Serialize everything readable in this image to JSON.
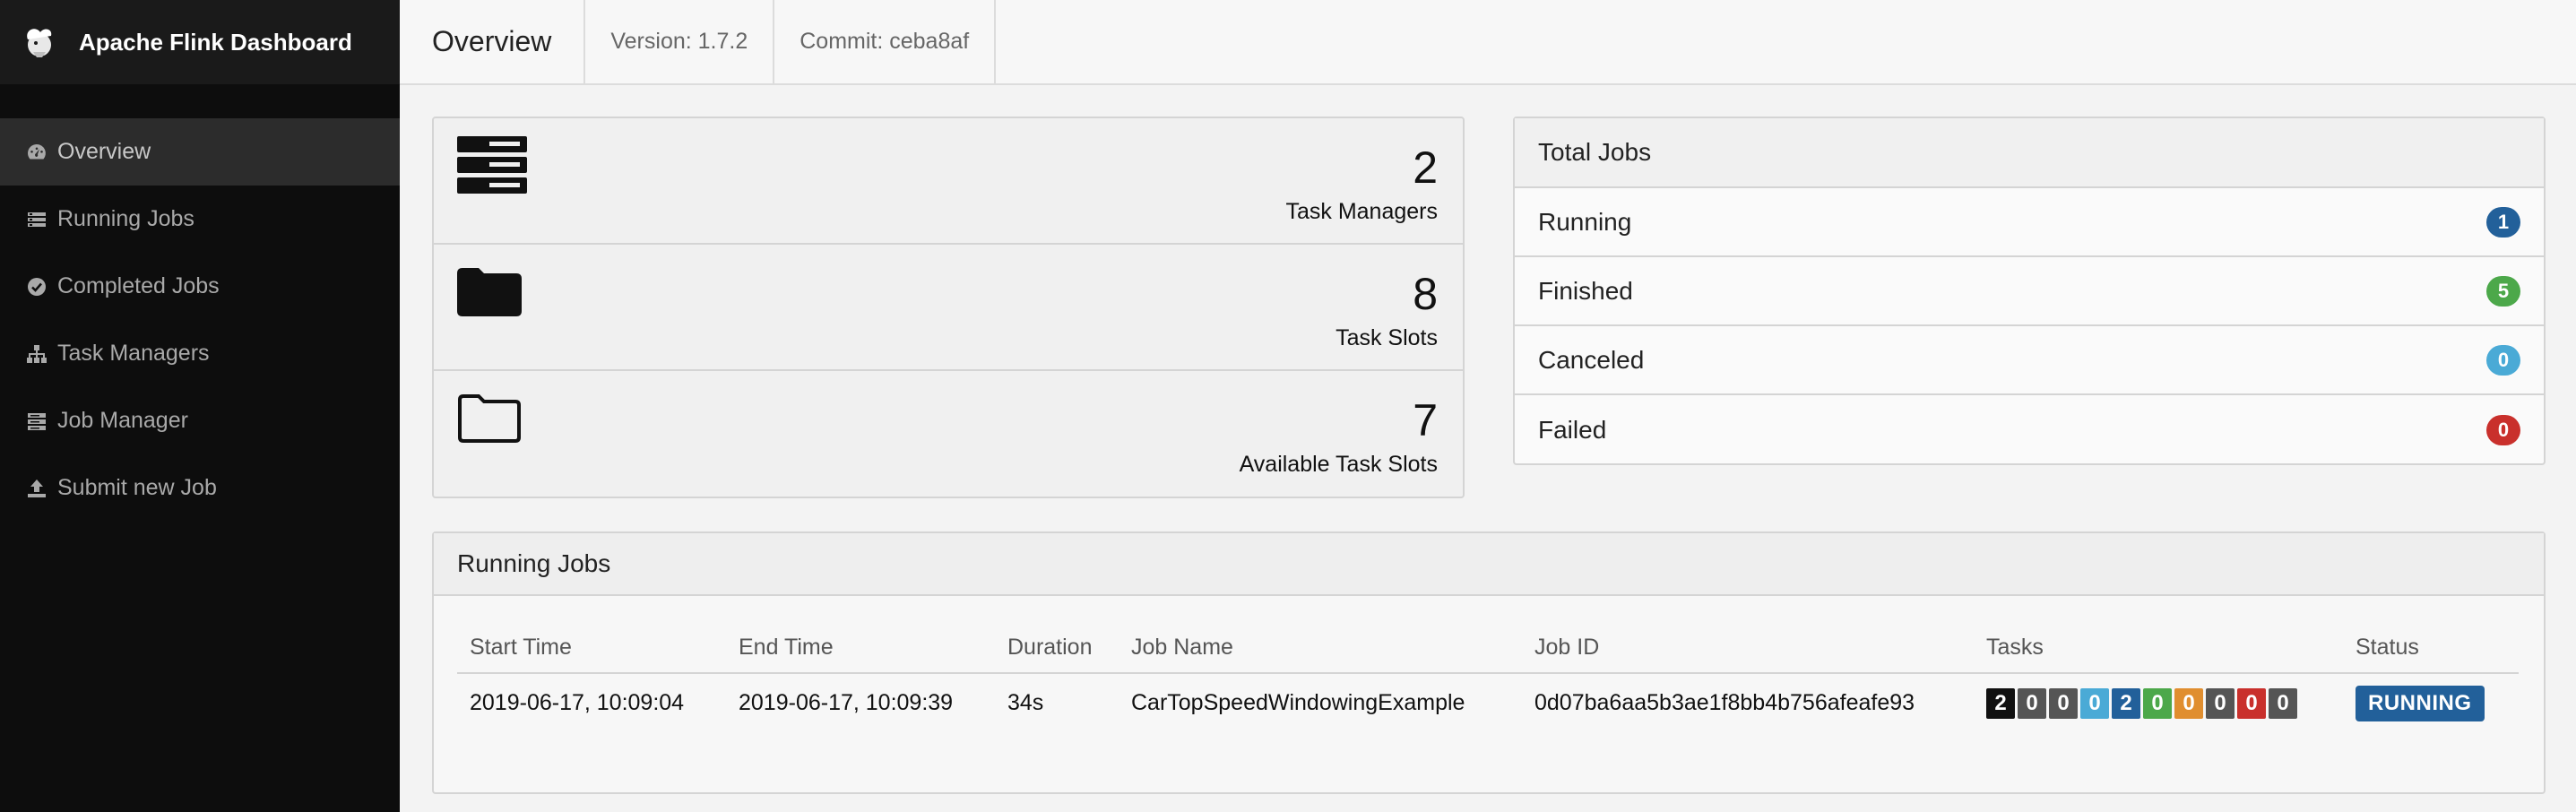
{
  "app": {
    "title": "Apache Flink Dashboard"
  },
  "sidebar": {
    "items": [
      {
        "label": "Overview",
        "icon": "dashboard-icon",
        "active": true
      },
      {
        "label": "Running Jobs",
        "icon": "tasks-icon"
      },
      {
        "label": "Completed Jobs",
        "icon": "check-circle-icon"
      },
      {
        "label": "Task Managers",
        "icon": "sitemap-icon"
      },
      {
        "label": "Job Manager",
        "icon": "server-icon"
      },
      {
        "label": "Submit new Job",
        "icon": "upload-icon"
      }
    ]
  },
  "header": {
    "title": "Overview",
    "version": "Version: 1.7.2",
    "commit": "Commit: ceba8af"
  },
  "stats": [
    {
      "value": "2",
      "label": "Task Managers",
      "icon": "server-icon"
    },
    {
      "value": "8",
      "label": "Task Slots",
      "icon": "folder-icon"
    },
    {
      "value": "7",
      "label": "Available Task Slots",
      "icon": "folder-open-icon"
    }
  ],
  "total_jobs": {
    "title": "Total Jobs",
    "rows": [
      {
        "label": "Running",
        "count": "1",
        "color": "#22609a"
      },
      {
        "label": "Finished",
        "count": "5",
        "color": "#4ca84a"
      },
      {
        "label": "Canceled",
        "count": "0",
        "color": "#4aaad6"
      },
      {
        "label": "Failed",
        "count": "0",
        "color": "#c9302c"
      }
    ]
  },
  "running_jobs": {
    "title": "Running Jobs",
    "columns": [
      "Start Time",
      "End Time",
      "Duration",
      "Job Name",
      "Job ID",
      "Tasks",
      "Status"
    ],
    "rows": [
      {
        "start_time": "2019-06-17, 10:09:04",
        "end_time": "2019-06-17, 10:09:39",
        "duration": "34s",
        "job_name": "CarTopSpeedWindowingExample",
        "job_id": "0d07ba6aa5b3ae1f8bb4b756afeafe93",
        "tasks": [
          {
            "value": "2",
            "color": "#111111"
          },
          {
            "value": "0",
            "color": "#555555"
          },
          {
            "value": "0",
            "color": "#555555"
          },
          {
            "value": "0",
            "color": "#4aaad6"
          },
          {
            "value": "2",
            "color": "#22609a"
          },
          {
            "value": "0",
            "color": "#4ca84a"
          },
          {
            "value": "0",
            "color": "#e08e2f"
          },
          {
            "value": "0",
            "color": "#555555"
          },
          {
            "value": "0",
            "color": "#c9302c"
          },
          {
            "value": "0",
            "color": "#555555"
          }
        ],
        "status": "RUNNING"
      }
    ]
  }
}
